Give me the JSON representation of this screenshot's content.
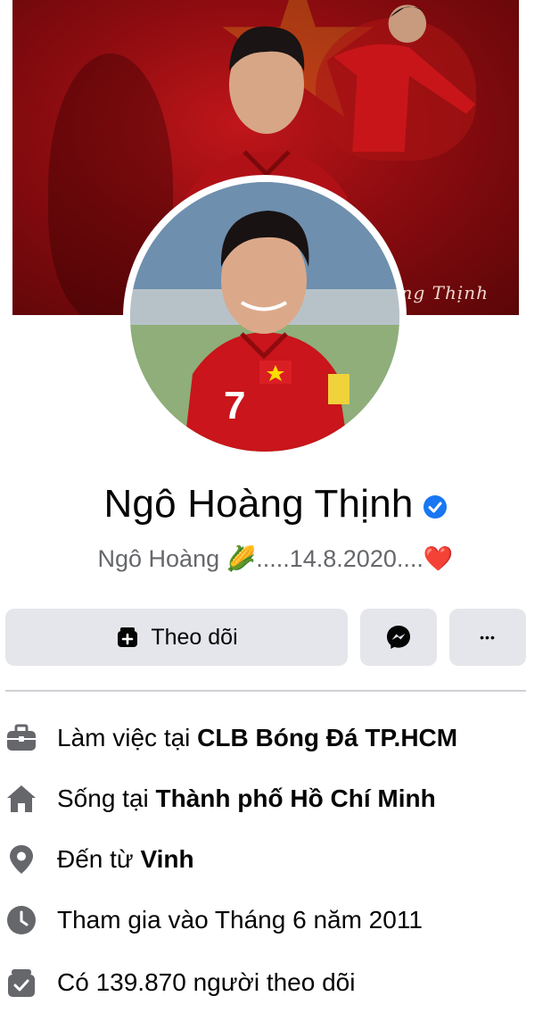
{
  "cover": {
    "signature": "oàng Thịnh"
  },
  "profile": {
    "name": "Ngô Hoàng Thịnh",
    "bio_prefix": "Ngô Hoàng ",
    "bio_suffix": ".....14.8.2020....",
    "bio_emoji_1": "🌽",
    "bio_emoji_2": "❤️"
  },
  "actions": {
    "follow_label": "Theo dõi",
    "more_label": "•••"
  },
  "details": [
    {
      "icon": "briefcase-icon",
      "prefix": "Làm việc tại ",
      "bold": "CLB Bóng Đá TP.HCM"
    },
    {
      "icon": "home-icon",
      "prefix": "Sống tại ",
      "bold": "Thành phố Hồ Chí Minh"
    },
    {
      "icon": "location-pin-icon",
      "prefix": "Đến từ ",
      "bold": "Vinh"
    },
    {
      "icon": "clock-icon",
      "prefix": "Tham gia vào Tháng 6 năm 2011",
      "bold": ""
    },
    {
      "icon": "followers-icon",
      "prefix": "Có 139.870 người theo dõi",
      "bold": ""
    }
  ],
  "colors": {
    "cover_red": "#c0161a",
    "verified_blue": "#1877f2",
    "button_gray": "#e4e6eb",
    "icon_gray": "#65676b"
  }
}
